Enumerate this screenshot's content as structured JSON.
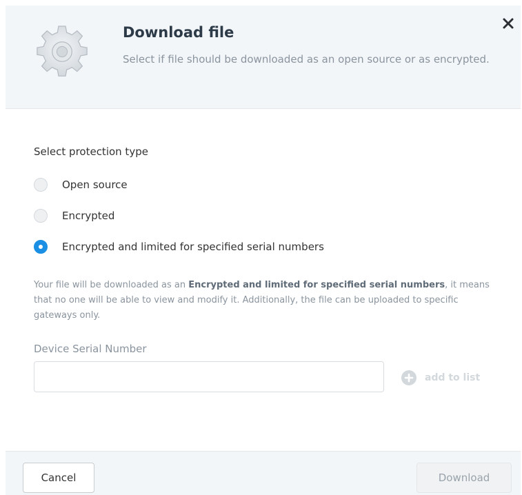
{
  "dialog": {
    "title": "Download file",
    "subtitle": "Select if file should be downloaded as an open source or as encrypted.",
    "close_label": "Close"
  },
  "protection": {
    "section_label": "Select protection type",
    "options": [
      {
        "label": "Open source",
        "checked": false
      },
      {
        "label": "Encrypted",
        "checked": false
      },
      {
        "label": "Encrypted and limited for specified serial numbers",
        "checked": true
      }
    ],
    "description": {
      "prefix": "Your file will be downloaded as an ",
      "emphasis": "Encrypted and limited for specified serial numbers",
      "suffix": ", it means that no one will be able to view and modify it. Additionally, the file can be uploaded to specific gateways only."
    }
  },
  "serial": {
    "label": "Device Serial Number",
    "value": "",
    "placeholder": "",
    "add_label": "add to list"
  },
  "footer": {
    "cancel_label": "Cancel",
    "download_label": "Download"
  },
  "colors": {
    "accent": "#1a8fe3",
    "header_bg": "#f3f6f9",
    "muted_text": "#8a949e"
  },
  "icons": {
    "header": "gear-icon",
    "close": "close-icon",
    "add": "plus-circle-icon"
  }
}
